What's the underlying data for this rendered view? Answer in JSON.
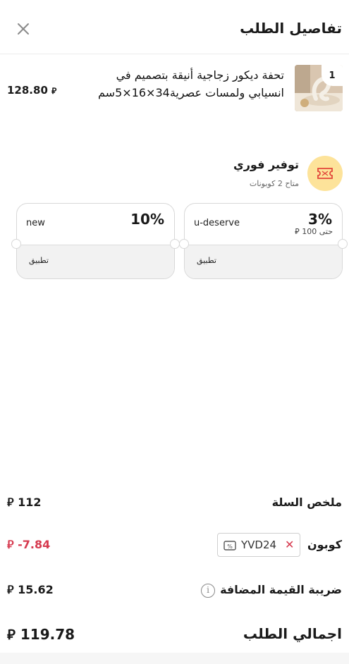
{
  "header": {
    "title": "تفاصيل الطلب"
  },
  "product": {
    "quantity": "1",
    "name": "تحفة ديكور زجاجية أنيقة بتصميم في انسيابي ولمسات عصرية34×16×5سم",
    "price": "128.80"
  },
  "currency_symbol": "ريال",
  "instant_saving": {
    "title": "توفير فوري",
    "subtitle": "متاح 2 كوبونات",
    "accent_color": "#fde39a"
  },
  "coupons": [
    {
      "percent": "3%",
      "code": "u-deserve",
      "limit": "حتى 100",
      "apply_label": "تطبيق"
    },
    {
      "percent": "10%",
      "code": "new",
      "apply_label": "تطبيق"
    }
  ],
  "summary": {
    "cart_label": "ملخص السلة",
    "cart_value": "112",
    "coupon_label": "كوبون",
    "coupon_code": "YVD24",
    "coupon_value": "-7.84",
    "vat_label": "ضريبة القيمة المضافة",
    "vat_value": "15.62",
    "total_label": "اجمالي الطلب",
    "total_value": "119.78",
    "discount_color": "#d63a4f"
  }
}
